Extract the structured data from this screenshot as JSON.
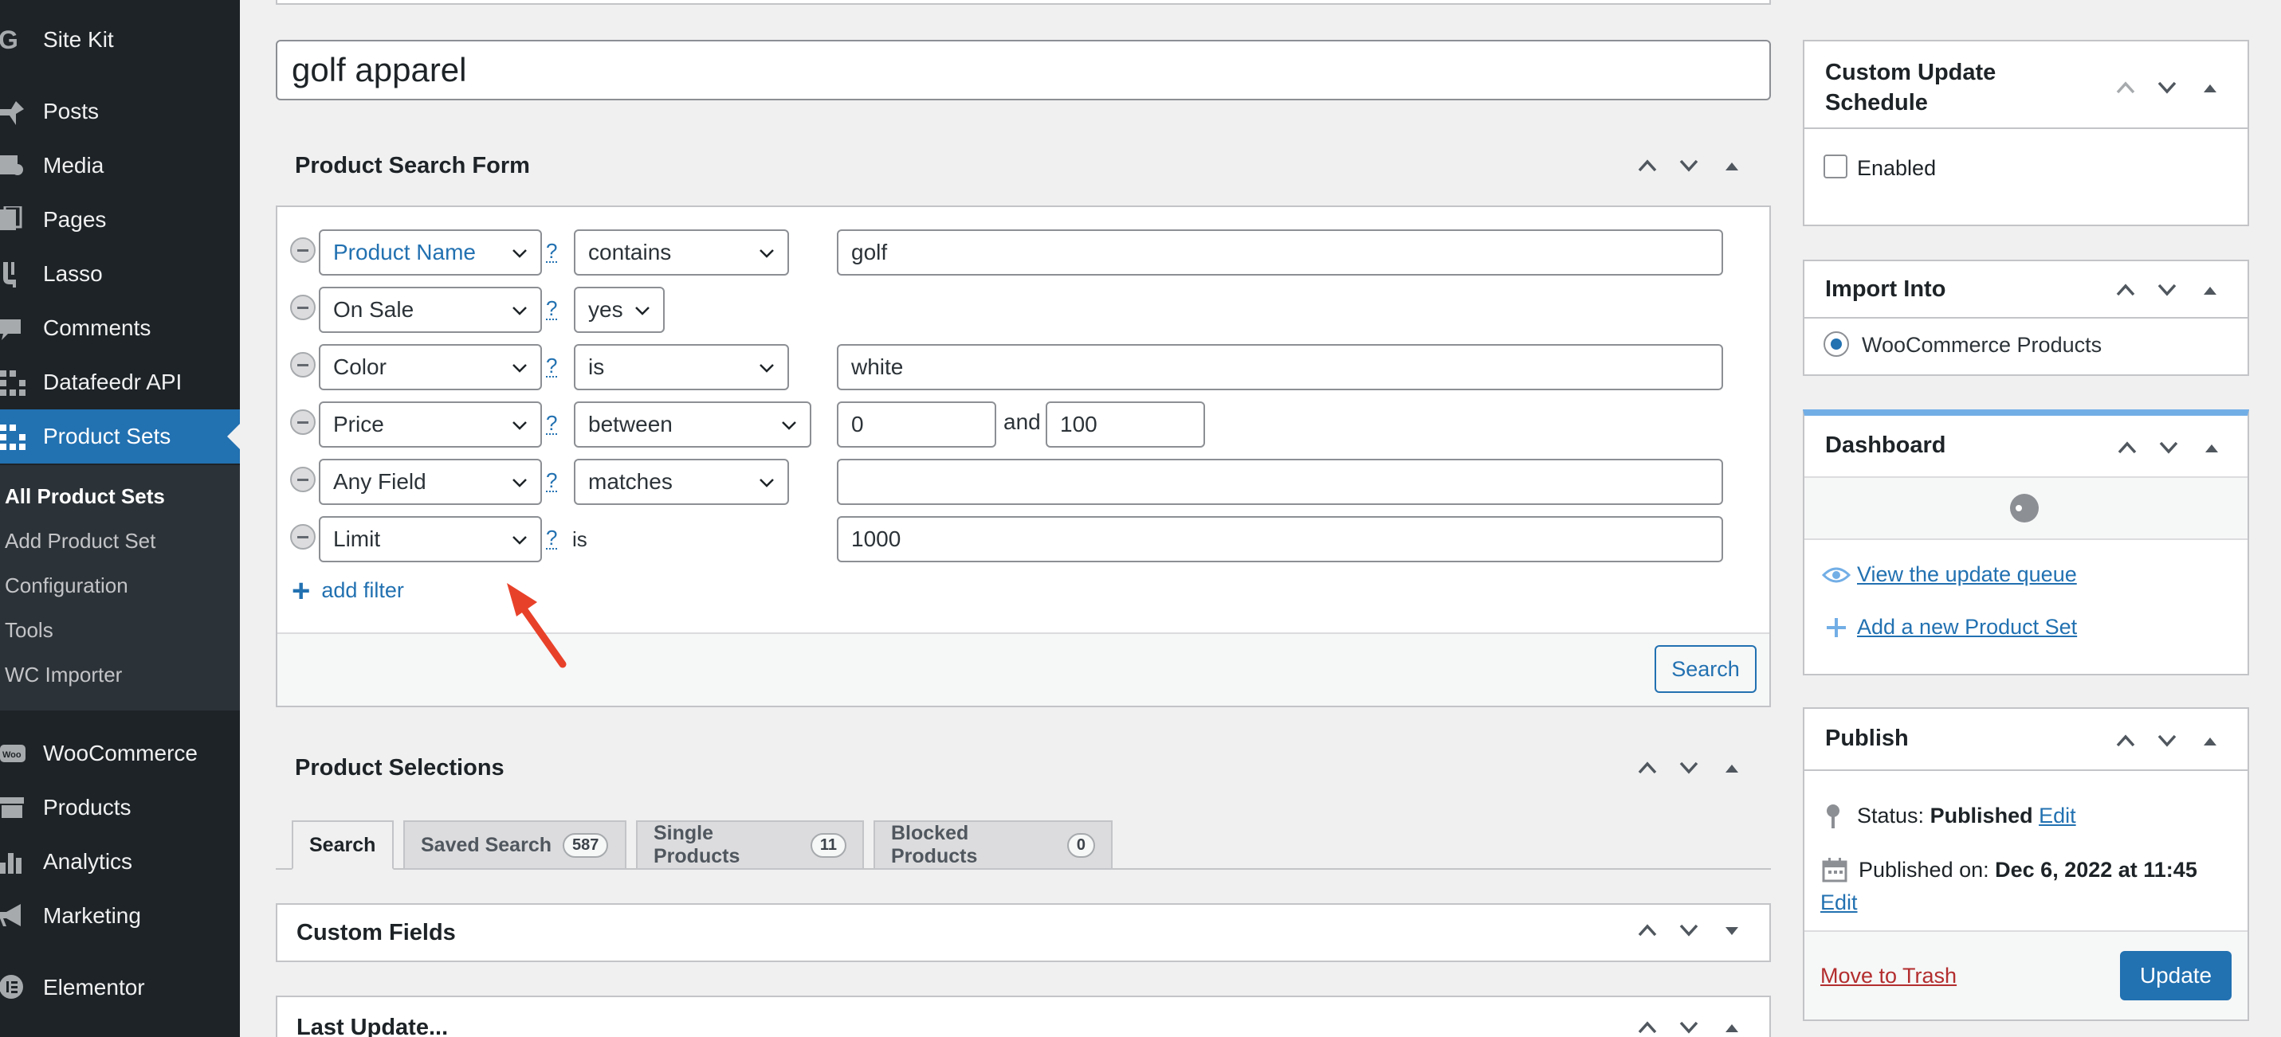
{
  "sidebar": {
    "items": [
      {
        "label": "Site Kit",
        "icon": "google-g-icon"
      },
      {
        "label": "Posts",
        "icon": "pushpin-icon"
      },
      {
        "label": "Media",
        "icon": "media-icon"
      },
      {
        "label": "Pages",
        "icon": "pages-icon"
      },
      {
        "label": "Lasso",
        "icon": "lasso-icon"
      },
      {
        "label": "Comments",
        "icon": "comment-bubble-icon"
      },
      {
        "label": "Datafeedr API",
        "icon": "datafeedr-icon"
      },
      {
        "label": "Product Sets",
        "icon": "datafeedr-icon"
      },
      {
        "label": "WooCommerce",
        "icon": "woo-icon"
      },
      {
        "label": "Products",
        "icon": "archive-icon"
      },
      {
        "label": "Analytics",
        "icon": "bar-chart-icon"
      },
      {
        "label": "Marketing",
        "icon": "megaphone-icon"
      },
      {
        "label": "Elementor",
        "icon": "elementor-icon"
      }
    ],
    "submenu": [
      "All Product Sets",
      "Add Product Set",
      "Configuration",
      "Tools",
      "WC Importer"
    ]
  },
  "title_value": "golf apparel",
  "search_form": {
    "title": "Product Search Form",
    "filters": [
      {
        "field": "Product Name",
        "op": "contains",
        "value": "golf"
      },
      {
        "field": "On Sale",
        "op": "yes"
      },
      {
        "field": "Color",
        "op": "is",
        "value": "white"
      },
      {
        "field": "Price",
        "op": "between",
        "value": "0",
        "and_label": "and",
        "value2": "100"
      },
      {
        "field": "Any Field",
        "op": "matches",
        "value": ""
      },
      {
        "field": "Limit",
        "op": "is",
        "value": "1000"
      }
    ],
    "help": "?",
    "add_filter": "add filter",
    "search_button": "Search"
  },
  "selections": {
    "title": "Product Selections",
    "tabs": [
      {
        "label": "Search"
      },
      {
        "label": "Saved Search",
        "count": "587"
      },
      {
        "label": "Single Products",
        "count": "11"
      },
      {
        "label": "Blocked Products",
        "count": "0"
      }
    ]
  },
  "custom_fields": {
    "title": "Custom Fields"
  },
  "last_update": {
    "title": "Last Update..."
  },
  "schedule": {
    "title_line1": "Custom Update",
    "title_line2": "Schedule",
    "enabled_label": "Enabled"
  },
  "import_into": {
    "title": "Import Into",
    "option": "WooCommerce Products"
  },
  "dashboard": {
    "title": "Dashboard",
    "view_queue": "View the update queue",
    "add_set": "Add a new Product Set"
  },
  "publish": {
    "title": "Publish",
    "status_label": "Status:",
    "status_value": "Published",
    "edit": "Edit",
    "published_label": "Published on:",
    "published_value": "Dec 6, 2022 at 11:45",
    "trash": "Move to Trash",
    "update": "Update"
  },
  "colors": {
    "sidebar_bg": "#1d2327",
    "accent": "#2271b1",
    "trash": "#b32d2e",
    "arrow": "#e8412a"
  }
}
